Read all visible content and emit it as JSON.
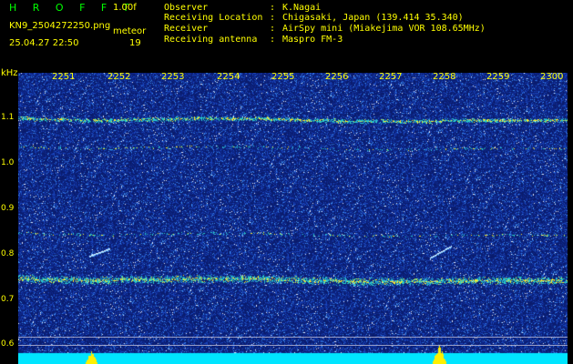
{
  "header": {
    "app_title": "H R O F F T",
    "version": "1.00f",
    "filename": "KN9_2504272250.png",
    "datetime": "25.04.27 22:50",
    "meteor_label": "meteor",
    "meteor_count": "19"
  },
  "info": [
    {
      "key": "Observer",
      "value": "K.Nagai"
    },
    {
      "key": "Receiving Location",
      "value": "Chigasaki, Japan (139.414 35.340)"
    },
    {
      "key": "Receiver",
      "value": "AirSpy mini (Miakejima VOR 108.65MHz)"
    },
    {
      "key": "Receiving antenna",
      "value": "Maspro FM-3"
    }
  ],
  "axes": {
    "y_unit": "kHz",
    "y_ticks": [
      "1.1",
      "1.0",
      "0.9",
      "0.8",
      "0.7",
      "0.6"
    ],
    "x_ticks": [
      "2251",
      "2252",
      "2253",
      "2254",
      "2255",
      "2256",
      "2257",
      "2258",
      "2259",
      "2300"
    ]
  },
  "colors": {
    "text": "#ffff00",
    "title": "#00ff00",
    "background": "#000000",
    "noise_floor": "#0a1d6e",
    "signal_baseline": "#00e5ff"
  }
}
